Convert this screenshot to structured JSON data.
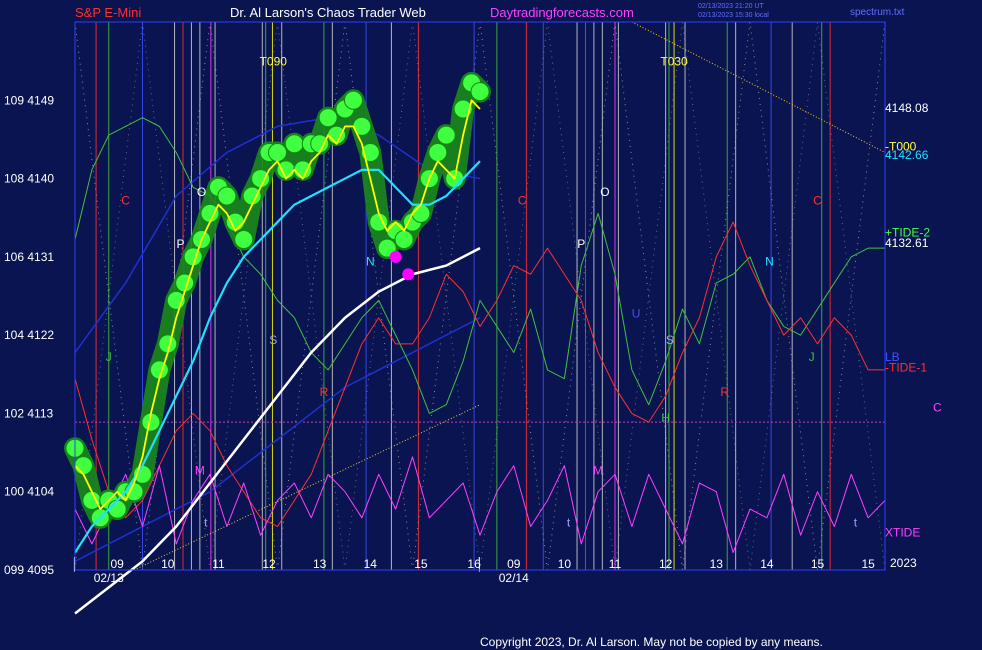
{
  "header": {
    "instrument": "S&P E-Mini",
    "site": "Dr. Al Larson's Chaos Trader Web",
    "url": "Daytradingforecasts.com",
    "updated": "02/13/2023 21:20 UT",
    "bars": "02/13/2023 15:30 local",
    "file": "spectrum.txt"
  },
  "footer": {
    "copyright": "Copyright 2023, Dr. Al Larson. May not be copied by any means."
  },
  "colors": {
    "background": "#0a1450",
    "frame": "#3040ff",
    "price": "#ffff00",
    "halo": "#40ff40",
    "ma_fast": "#20e0ff",
    "ma_slow": "#ffffff",
    "tide": "#40c040",
    "tide_neg": "#ff3030",
    "xtide": "#ff40ff"
  },
  "chart_data": {
    "type": "line",
    "title": "S&P E-Mini",
    "xlabel": "",
    "ylabel": "",
    "ylim": [
      4095,
      4158
    ],
    "x_range": [
      0,
      48
    ],
    "y_ticks": [
      {
        "value": 4095,
        "label": "099 4095"
      },
      {
        "value": 4104,
        "label": "100 4104"
      },
      {
        "value": 4113,
        "label": "102 4113"
      },
      {
        "value": 4122,
        "label": "104 4122"
      },
      {
        "value": 4131,
        "label": "106 4131"
      },
      {
        "value": 4140,
        "label": "108 4140"
      },
      {
        "value": 4149,
        "label": "109 4149"
      }
    ],
    "x_ticks": [
      {
        "x": 0,
        "label": "│"
      },
      {
        "x": 5,
        "label": "09"
      },
      {
        "x": 11,
        "label": "10"
      },
      {
        "x": 17,
        "label": "11"
      },
      {
        "x": 23,
        "label": "12"
      },
      {
        "x": 29,
        "label": "13"
      },
      {
        "x": 35,
        "label": "14"
      },
      {
        "x": 41,
        "label": "15"
      },
      {
        "x": 47.3,
        "label": "16"
      },
      {
        "x": 48,
        "label": "│"
      },
      {
        "x": 52,
        "label": "09"
      },
      {
        "x": 58,
        "label": "10"
      },
      {
        "x": 64,
        "label": "11"
      },
      {
        "x": 70,
        "label": "12"
      },
      {
        "x": 76,
        "label": "13"
      },
      {
        "x": 82,
        "label": "14"
      },
      {
        "x": 88,
        "label": "15"
      },
      {
        "x": 94,
        "label": "15"
      }
    ],
    "date_labels": [
      {
        "x": 4,
        "label": "02/13"
      },
      {
        "x": 52,
        "label": "02/14"
      }
    ],
    "year": "2023",
    "series": [
      {
        "name": "",
        "role": "halo",
        "x": [
          0,
          1,
          2,
          3,
          4,
          5,
          6,
          7,
          8,
          9,
          10,
          11,
          12,
          13,
          14,
          15,
          16,
          17,
          18,
          19,
          20,
          21,
          22,
          23,
          24,
          25,
          26,
          27,
          28,
          29,
          30,
          31,
          32,
          33,
          34,
          35,
          36,
          37,
          38,
          39,
          40,
          41,
          42,
          43,
          44,
          45,
          46,
          47,
          48
        ],
        "values": [
          4109,
          4107,
          4103,
          4101,
          4103,
          4102,
          4104,
          4104,
          4106,
          4112,
          4118,
          4121,
          4126,
          4128,
          4131,
          4133,
          4136,
          4139,
          4138,
          4135,
          4133,
          4138,
          4140,
          4143,
          4143,
          4141,
          4144,
          4141,
          4144,
          4144,
          4147,
          4145,
          4148,
          4149,
          4146,
          4143,
          4135,
          4132,
          4134,
          4133,
          4135,
          4136,
          4140,
          4143,
          4145,
          4140,
          4148,
          4151,
          4150
        ]
      },
      {
        "name": "",
        "role": "price",
        "x": [
          0,
          1,
          2,
          3,
          4,
          5,
          6,
          7,
          8,
          9,
          10,
          11,
          12,
          13,
          14,
          15,
          16,
          17,
          18,
          19,
          20,
          21,
          22,
          23,
          24,
          25,
          26,
          27,
          28,
          29,
          30,
          31,
          32,
          33,
          34,
          35,
          36,
          37,
          38,
          39,
          40,
          41,
          42,
          43,
          44,
          45,
          46,
          47,
          48
        ],
        "values": [
          4107,
          4106,
          4104,
          4102,
          4103,
          4104,
          4103,
          4105,
          4108,
          4113,
          4117,
          4120,
          4124,
          4127,
          4130,
          4133,
          4135,
          4137,
          4136,
          4134,
          4135,
          4137,
          4139,
          4141,
          4142,
          4140,
          4141,
          4140,
          4142,
          4143,
          4145,
          4144,
          4146,
          4146,
          4144,
          4140,
          4136,
          4134,
          4135,
          4134,
          4136,
          4137,
          4140,
          4142,
          4141,
          4140,
          4145,
          4149,
          4148
        ]
      },
      {
        "name": "",
        "role": "ma_fast",
        "x": [
          0,
          2,
          4,
          6,
          8,
          10,
          12,
          14,
          16,
          18,
          20,
          22,
          24,
          26,
          28,
          30,
          32,
          34,
          36,
          38,
          40,
          42,
          44,
          46,
          48
        ],
        "values": [
          4097,
          4100,
          4102,
          4104,
          4107,
          4111,
          4115,
          4119,
          4124,
          4128,
          4131,
          4133,
          4135,
          4137,
          4138,
          4139,
          4140,
          4141,
          4141,
          4139,
          4137,
          4137,
          4138,
          4140,
          4142
        ]
      },
      {
        "name": "",
        "role": "ma_slow",
        "x": [
          0,
          4,
          8,
          12,
          16,
          20,
          24,
          28,
          32,
          36,
          40,
          44,
          48
        ],
        "values": [
          4090,
          4093,
          4096,
          4100,
          4105,
          4110,
          4115,
          4120,
          4124,
          4127,
          4129,
          4130,
          4132
        ]
      },
      {
        "name": "",
        "role": "tide",
        "x": [
          0,
          2,
          4,
          6,
          8,
          10,
          12,
          14,
          16,
          18,
          20,
          22,
          24,
          26,
          28,
          30,
          32,
          34,
          36,
          38,
          40,
          42,
          44,
          46,
          48,
          50,
          52,
          54,
          56,
          58,
          60,
          62,
          64,
          66,
          68,
          70,
          72,
          74,
          76,
          78,
          80,
          82,
          84,
          86,
          88,
          90,
          92,
          94,
          96
        ],
        "values": [
          4133,
          4141,
          4145,
          4146,
          4147,
          4146,
          4143,
          4139,
          4138,
          4135,
          4131,
          4129,
          4126,
          4124,
          4120,
          4118,
          4121,
          4124,
          4126,
          4122,
          4118,
          4113,
          4114,
          4119,
          4126,
          4123,
          4120,
          4125,
          4118,
          4117,
          4130,
          4136,
          4129,
          4118,
          4114,
          4119,
          4125,
          4121,
          4128,
          4129,
          4131,
          4126,
          4123,
          4122,
          4125,
          4128,
          4131,
          4132,
          4132
        ]
      },
      {
        "name": "",
        "role": "tide_neg",
        "x": [
          0,
          2,
          4,
          6,
          8,
          10,
          12,
          14,
          16,
          18,
          20,
          22,
          24,
          26,
          28,
          30,
          32,
          34,
          36,
          38,
          40,
          42,
          44,
          46,
          48,
          50,
          52,
          54,
          56,
          58,
          60,
          62,
          64,
          66,
          68,
          70,
          72,
          74,
          76,
          78,
          80,
          82,
          84,
          86,
          88,
          90,
          92,
          94,
          96
        ],
        "values": [
          4117,
          4110,
          4104,
          4101,
          4103,
          4107,
          4111,
          4113,
          4111,
          4107,
          4104,
          4101,
          4100,
          4103,
          4106,
          4111,
          4116,
          4121,
          4124,
          4121,
          4121,
          4124,
          4129,
          4127,
          4123,
          4126,
          4130,
          4129,
          4132,
          4129,
          4126,
          4120,
          4116,
          4113,
          4112,
          4115,
          4120,
          4124,
          4131,
          4135,
          4130,
          4126,
          4122,
          4124,
          4121,
          4124,
          4122,
          4118,
          4118
        ]
      },
      {
        "name": "",
        "role": "xtide",
        "x": [
          0,
          2,
          4,
          6,
          8,
          10,
          12,
          14,
          16,
          18,
          20,
          22,
          24,
          26,
          28,
          30,
          32,
          34,
          36,
          38,
          40,
          42,
          44,
          46,
          48,
          50,
          52,
          54,
          56,
          58,
          60,
          62,
          64,
          66,
          68,
          70,
          72,
          74,
          76,
          78,
          80,
          82,
          84,
          86,
          88,
          90,
          92,
          94,
          96
        ],
        "values": [
          4102,
          4098,
          4102,
          4106,
          4100,
          4107,
          4098,
          4103,
          4106,
          4100,
          4105,
          4099,
          4103,
          4105,
          4101,
          4106,
          4104,
          4101,
          4106,
          4102,
          4108,
          4101,
          4103,
          4105,
          4099,
          4104,
          4107,
          4100,
          4103,
          4107,
          4098,
          4104,
          4106,
          4100,
          4106,
          4102,
          4098,
          4105,
          4104,
          4097,
          4102,
          4101,
          4106,
          4099,
          4104,
          4100,
          4106,
          4101,
          4103
        ]
      }
    ],
    "ma_extra": [
      {
        "role": "ma_blue",
        "x": [
          0,
          6,
          12,
          18,
          24,
          30,
          36,
          42,
          48
        ],
        "values": [
          4120,
          4128,
          4138,
          4143,
          4146,
          4147,
          4145,
          4141,
          4140
        ]
      },
      {
        "role": "ma_blue2",
        "x": [
          0,
          8,
          16,
          24,
          32,
          40,
          48
        ],
        "values": [
          4096,
          4100,
          4104,
          4110,
          4116,
          4120,
          4124
        ]
      }
    ],
    "markers": [
      {
        "x": 38,
        "y": 4131,
        "color": "#ff00ff"
      },
      {
        "x": 39.5,
        "y": 4129,
        "color": "#ff00ff"
      }
    ],
    "vlines": [
      {
        "x": 2.5,
        "color": "#ff3030"
      },
      {
        "x": 4,
        "color": "#40c040"
      },
      {
        "x": 8,
        "color": "#4050ff"
      },
      {
        "x": 11.8,
        "color": "#d0d0d0"
      },
      {
        "x": 12.8,
        "color": "#ff3030"
      },
      {
        "x": 13.8,
        "color": "#d0d0d0"
      },
      {
        "x": 14.8,
        "color": "#d0d0d0"
      },
      {
        "x": 16.1,
        "color": "#ff40ff"
      },
      {
        "x": 16.6,
        "color": "#d0d0d0"
      },
      {
        "x": 22.2,
        "color": "#d0d0d0"
      },
      {
        "x": 22.6,
        "color": "#40c040"
      },
      {
        "x": 23.4,
        "color": "#ffff00"
      },
      {
        "x": 24.5,
        "color": "#d0d0d0"
      },
      {
        "x": 29.5,
        "color": "#40c040"
      },
      {
        "x": 30.5,
        "color": "#d0d0d0"
      },
      {
        "x": 34.5,
        "color": "#4050ff"
      },
      {
        "x": 37.5,
        "color": "#d0d0d0"
      },
      {
        "x": 40.7,
        "color": "#ff3030"
      },
      {
        "x": 47.3,
        "color": "#4050ff"
      },
      {
        "x": 50,
        "color": "#40c040"
      },
      {
        "x": 53.5,
        "color": "#ff3030"
      },
      {
        "x": 55.5,
        "color": "#4050ff"
      },
      {
        "x": 59.5,
        "color": "#d0d0d0"
      },
      {
        "x": 60.5,
        "color": "#ff3030"
      },
      {
        "x": 61.5,
        "color": "#d0d0d0"
      },
      {
        "x": 62.5,
        "color": "#d0d0d0"
      },
      {
        "x": 64,
        "color": "#ff40ff"
      },
      {
        "x": 64.4,
        "color": "#d0d0d0"
      },
      {
        "x": 70,
        "color": "#d0d0d0"
      },
      {
        "x": 70.4,
        "color": "#40c040"
      },
      {
        "x": 71,
        "color": "#ffff00"
      },
      {
        "x": 72.3,
        "color": "#d0d0d0"
      },
      {
        "x": 77.3,
        "color": "#40c040"
      },
      {
        "x": 78.3,
        "color": "#d0d0d0"
      },
      {
        "x": 82.5,
        "color": "#4050ff"
      },
      {
        "x": 85,
        "color": "#d0d0d0"
      },
      {
        "x": 88.5,
        "color": "#40c040"
      },
      {
        "x": 89.5,
        "color": "#ff3030"
      }
    ],
    "guides": [
      {
        "x1": 0,
        "y1": 4112,
        "x2": 96,
        "y2": 4112,
        "color": "#c040c0",
        "dash": "2,2"
      },
      {
        "x1": 7,
        "y1": 4095,
        "x2": 48,
        "y2": 4114,
        "color": "#ffd000",
        "dash": "1,2"
      },
      {
        "x1": 66,
        "y1": 4158,
        "x2": 96,
        "y2": 4143,
        "color": "#ffd000",
        "dash": "1,2"
      }
    ],
    "annotations": [
      {
        "x": 6,
        "y": 4137,
        "text": "C",
        "color": "#ff3030"
      },
      {
        "x": 12.5,
        "y": 4132,
        "text": "P",
        "color": "#ffffff"
      },
      {
        "x": 15,
        "y": 4138,
        "text": "O",
        "color": "#ffffff"
      },
      {
        "x": 23.5,
        "y": 4153,
        "text": "T090",
        "color": "#ffff40"
      },
      {
        "x": 23.5,
        "y": 4121,
        "text": "S",
        "color": "#a0a0ff"
      },
      {
        "x": 29.5,
        "y": 4115,
        "text": "R",
        "color": "#ff3030"
      },
      {
        "x": 35,
        "y": 4130,
        "text": "N",
        "color": "#20e0ff"
      },
      {
        "x": 4,
        "y": 4119,
        "text": "J",
        "color": "#40c040"
      },
      {
        "x": 14.8,
        "y": 4106,
        "text": "M",
        "color": "#ff40ff"
      },
      {
        "x": 15.5,
        "y": 4100,
        "text": "t",
        "color": "#a0a0ff"
      },
      {
        "x": 53,
        "y": 4137,
        "text": "C",
        "color": "#ff3030"
      },
      {
        "x": 60,
        "y": 4132,
        "text": "P",
        "color": "#ffffff"
      },
      {
        "x": 62.8,
        "y": 4138,
        "text": "O",
        "color": "#ffffff"
      },
      {
        "x": 71,
        "y": 4153,
        "text": "T030",
        "color": "#ffff40"
      },
      {
        "x": 66.5,
        "y": 4124,
        "text": "U",
        "color": "#4050ff"
      },
      {
        "x": 70.5,
        "y": 4121,
        "text": "S",
        "color": "#a0a0ff"
      },
      {
        "x": 77,
        "y": 4115,
        "text": "R",
        "color": "#ff3030"
      },
      {
        "x": 82.3,
        "y": 4130,
        "text": "N",
        "color": "#20e0ff"
      },
      {
        "x": 70,
        "y": 4112,
        "text": "H",
        "color": "#40c040"
      },
      {
        "x": 88,
        "y": 4137,
        "text": "C",
        "color": "#ff3030"
      },
      {
        "x": 87.3,
        "y": 4119,
        "text": "J",
        "color": "#40c040"
      },
      {
        "x": 62,
        "y": 4106,
        "text": "M",
        "color": "#ff40ff"
      },
      {
        "x": 58.5,
        "y": 4100,
        "text": "t",
        "color": "#a0a0ff"
      },
      {
        "x": 92.5,
        "y": 4100,
        "text": "t",
        "color": "#a0a0ff"
      }
    ],
    "right_labels": [
      {
        "y": 4148.1,
        "text": "4148.08",
        "color": "#ffffff"
      },
      {
        "y": 4143.7,
        "text": "-T000",
        "color": "#ffff40"
      },
      {
        "y": 4142.7,
        "text": "4142.66",
        "color": "#20e0ff"
      },
      {
        "y": 4133.8,
        "text": "+TIDE-2",
        "color": "#40ff40"
      },
      {
        "y": 4132.6,
        "text": "4132.61",
        "color": "#ffffff"
      },
      {
        "y": 4119.5,
        "text": "LB",
        "color": "#4050ff"
      },
      {
        "y": 4118.3,
        "text": "-TIDE-1",
        "color": "#ff3030"
      },
      {
        "y": 4113.7,
        "text": "C",
        "color": "#ff40ff"
      },
      {
        "y": 4099.3,
        "text": "XTIDE",
        "color": "#ff40ff"
      }
    ]
  }
}
